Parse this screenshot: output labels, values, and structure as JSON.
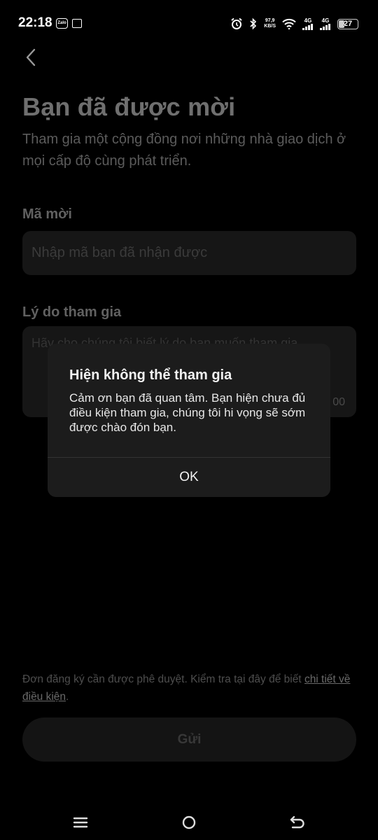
{
  "status_bar": {
    "time": "22:18",
    "zalo_label": "Zalo",
    "speed_value": "97,9",
    "speed_unit": "KB/S",
    "net1": "4G",
    "net2": "4G",
    "battery": "27"
  },
  "page": {
    "title": "Bạn đã được mời",
    "subtitle": "Tham gia một cộng đồng nơi những nhà giao dịch ở mọi cấp độ cùng phát triển."
  },
  "form": {
    "code_label": "Mã mời",
    "code_placeholder": "Nhập mã bạn đã nhận được",
    "reason_label": "Lý do tham gia",
    "reason_placeholder": "Hãy cho chúng tôi biết lý do bạn muốn tham gia",
    "reason_counter": "00"
  },
  "footer": {
    "note": "Đơn đăng ký cần được phê duyệt. Kiểm tra tại đây để biết ",
    "note_link": "chi tiết về điều kiện",
    "note_end": ".",
    "submit_label": "Gửi"
  },
  "dialog": {
    "title": "Hiện không thể tham gia",
    "message": "Cảm ơn bạn đã quan tâm. Bạn hiện chưa đủ điều kiện tham gia, chúng tôi hi vọng sẽ sớm được chào đón bạn.",
    "ok_label": "OK"
  },
  "colors": {
    "background": "#000000",
    "dialog_bg": "#1c1c1c",
    "input_bg": "#161616"
  }
}
